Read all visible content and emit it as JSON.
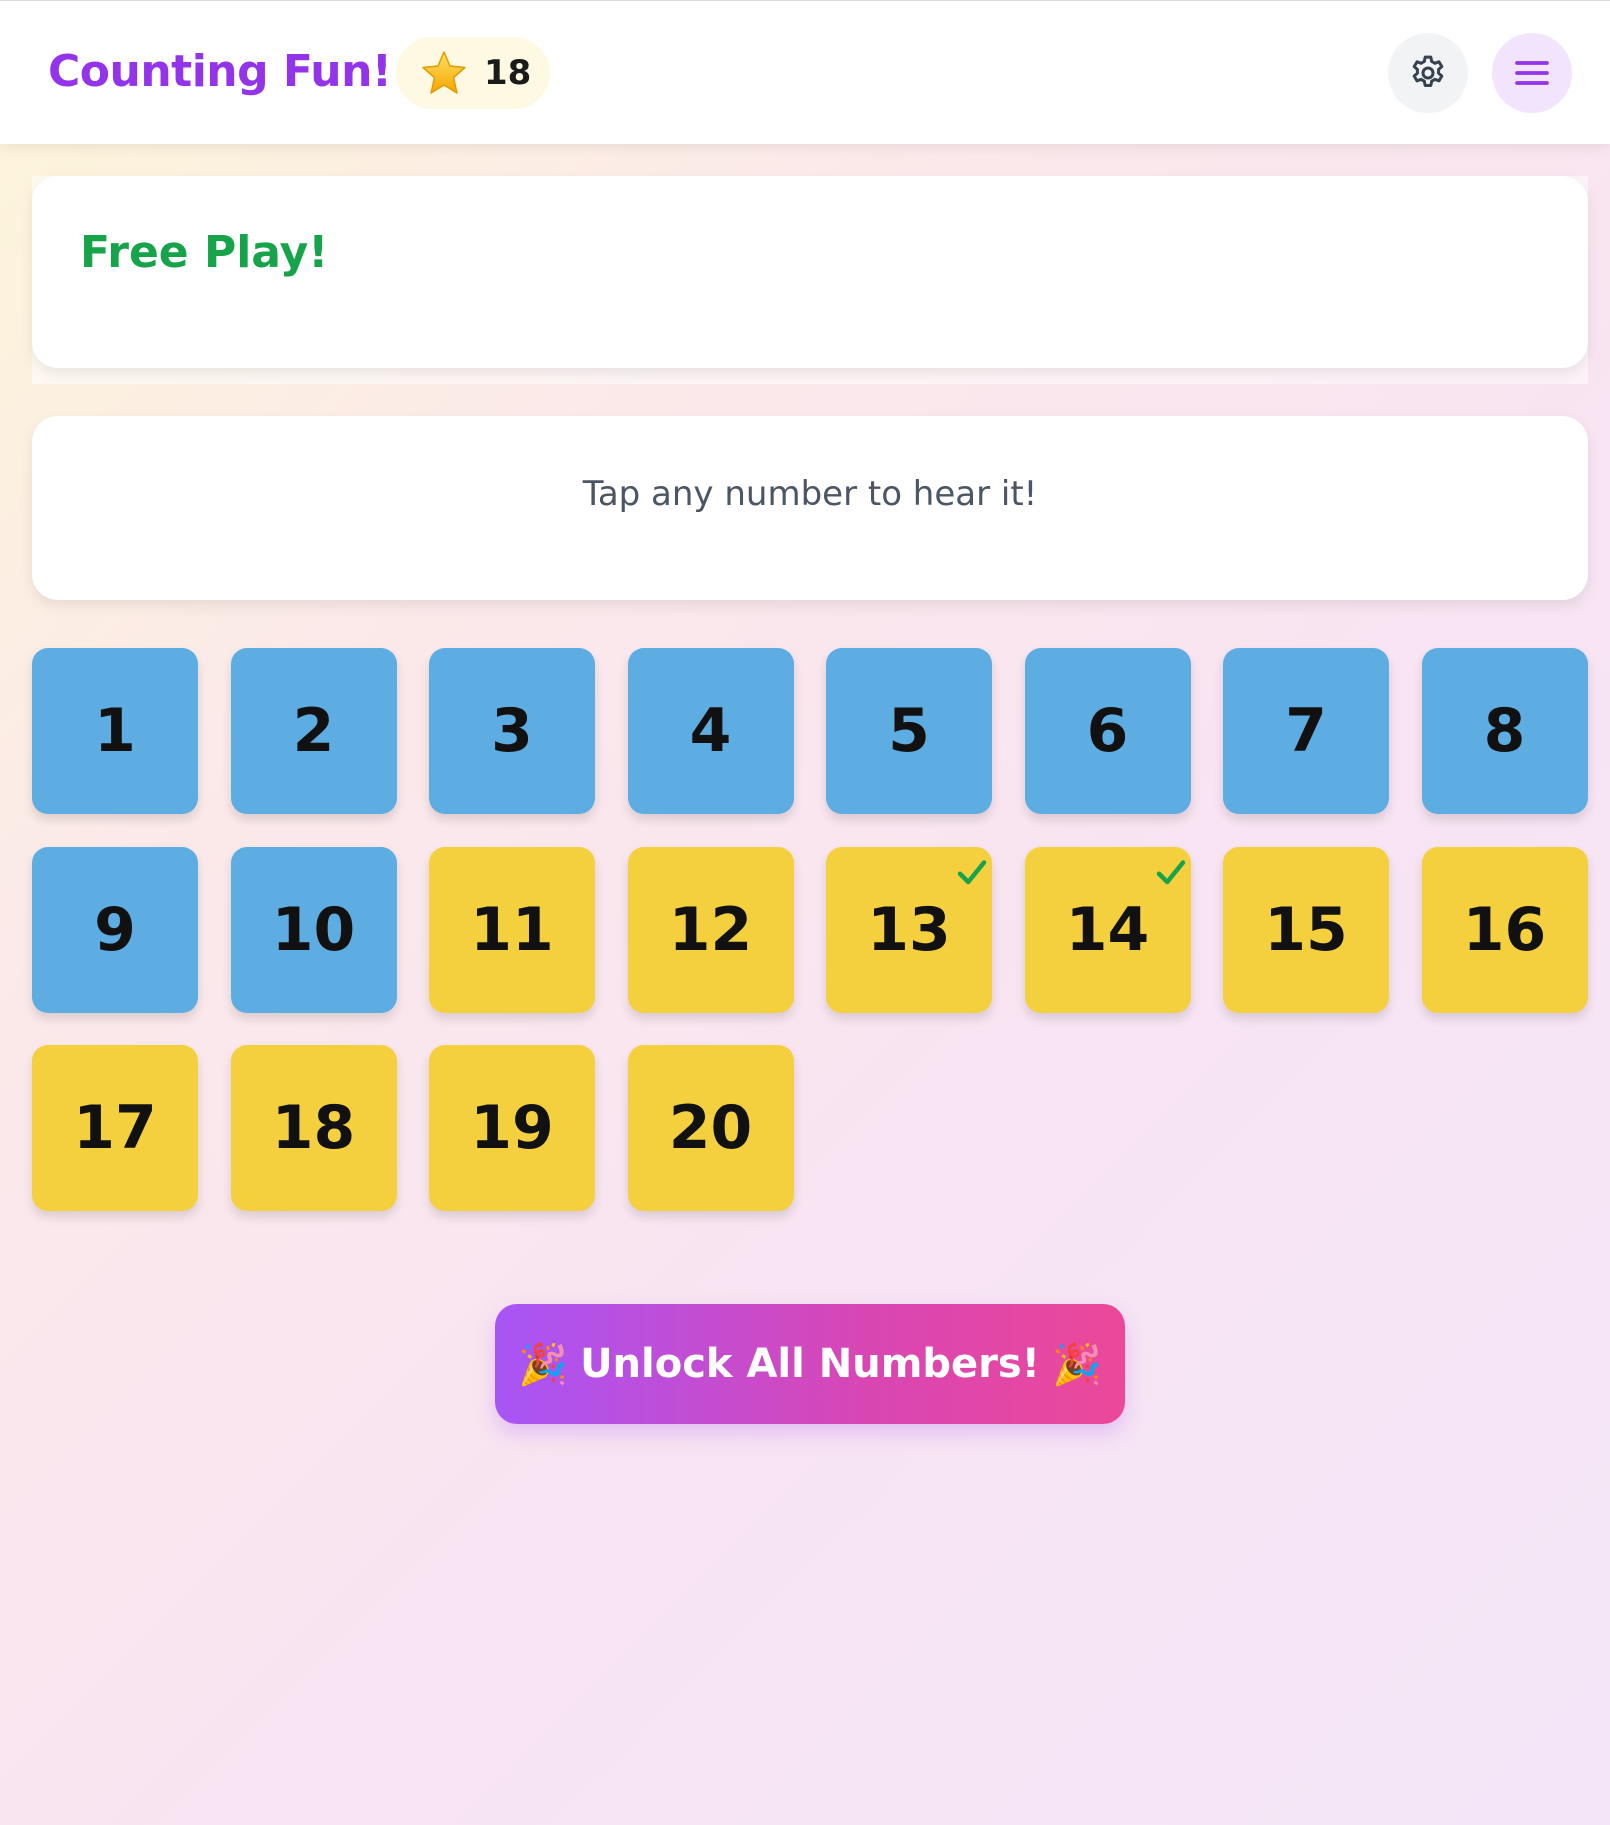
{
  "header": {
    "title": "Counting Fun!",
    "stars": "18",
    "star_icon": "star-icon",
    "settings_icon": "gear-icon",
    "menu_icon": "hamburger-menu-icon"
  },
  "mode": {
    "title": "Free Play!"
  },
  "instruction": {
    "text": "Tap any number to hear it!"
  },
  "numbers": [
    {
      "label": "1",
      "color": "blue",
      "checked": false
    },
    {
      "label": "2",
      "color": "blue",
      "checked": false
    },
    {
      "label": "3",
      "color": "blue",
      "checked": false
    },
    {
      "label": "4",
      "color": "blue",
      "checked": false
    },
    {
      "label": "5",
      "color": "blue",
      "checked": false
    },
    {
      "label": "6",
      "color": "blue",
      "checked": false
    },
    {
      "label": "7",
      "color": "blue",
      "checked": false
    },
    {
      "label": "8",
      "color": "blue",
      "checked": false
    },
    {
      "label": "9",
      "color": "blue",
      "checked": false
    },
    {
      "label": "10",
      "color": "blue",
      "checked": false
    },
    {
      "label": "11",
      "color": "yellow",
      "checked": false
    },
    {
      "label": "12",
      "color": "yellow",
      "checked": false
    },
    {
      "label": "13",
      "color": "yellow",
      "checked": true
    },
    {
      "label": "14",
      "color": "yellow",
      "checked": true
    },
    {
      "label": "15",
      "color": "yellow",
      "checked": false
    },
    {
      "label": "16",
      "color": "yellow",
      "checked": false
    },
    {
      "label": "17",
      "color": "yellow",
      "checked": false
    },
    {
      "label": "18",
      "color": "yellow",
      "checked": false
    },
    {
      "label": "19",
      "color": "yellow",
      "checked": false
    },
    {
      "label": "20",
      "color": "yellow",
      "checked": false
    }
  ],
  "unlock": {
    "label": "Unlock All Numbers!",
    "emoji_left": "🎉",
    "emoji_right": "🎉"
  },
  "colors": {
    "accent_purple": "#9333ea",
    "success_green": "#16a34a",
    "tile_blue": "#5dade2",
    "tile_yellow": "#f4d03f"
  }
}
